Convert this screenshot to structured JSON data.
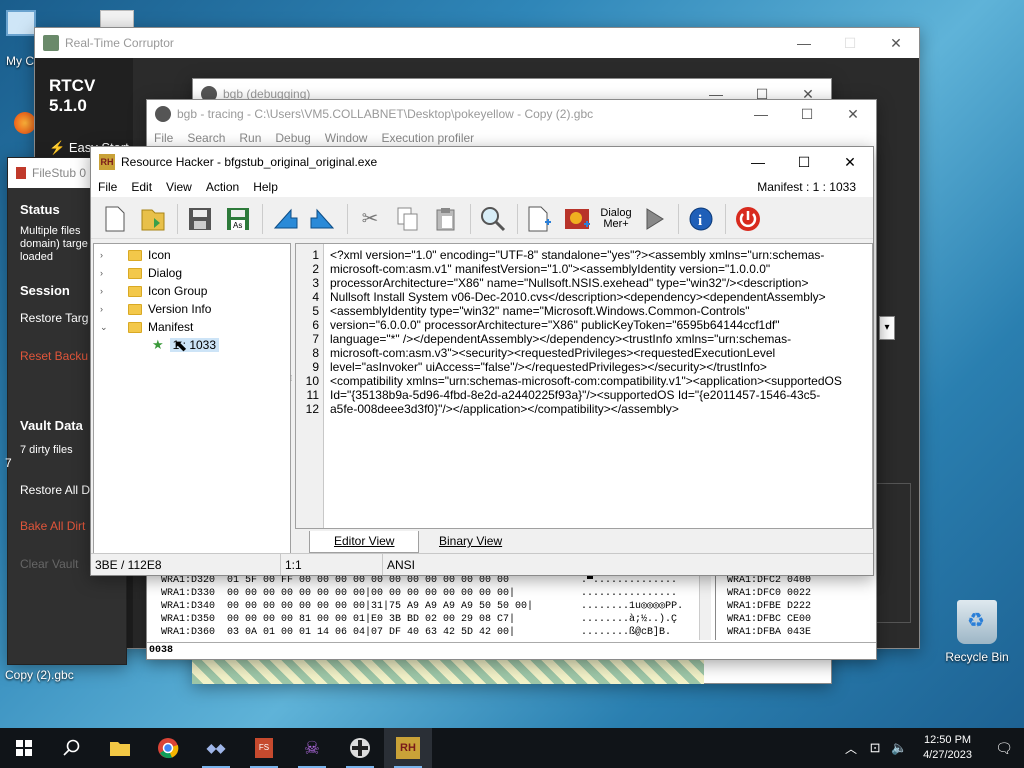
{
  "desktop": {
    "my_computer_label": "My Co",
    "recycle_bin_label": "Recycle Bin",
    "copy_label": "Copy (2).gbc"
  },
  "rtcv": {
    "title": "Real-Time Corruptor",
    "version": "RTCV 5.1.0",
    "easy_start": "Easy Start"
  },
  "filestub": {
    "title": "FileStub 0",
    "status_heading": "Status",
    "status_text_1": "Multiple files",
    "status_text_2": "domain) targe",
    "status_text_3": "loaded",
    "session_heading": "Session",
    "restore_target": "Restore Targ",
    "reset_backup": "Reset Backu",
    "vault_heading": "Vault Data",
    "dirty_files": "7 dirty files",
    "restore_all": "Restore All D",
    "bake_all": "Bake All Dirt",
    "clear_vault": "Clear Vault"
  },
  "bgb_debug": {
    "title": "bgb (debugging)"
  },
  "bgb_trace": {
    "title": "bgb - tracing - C:\\Users\\VM5.COLLABNET\\Desktop\\pokeyellow - Copy (2).gbc",
    "menu": [
      "File",
      "Search",
      "Run",
      "Debug",
      "Window",
      "Execution profiler"
    ],
    "hex_lines": [
      "WRA1:D320  01 5F 00 FF 00 00 00 00 00 00 00 00 00 00 00 00",
      "WRA1:D330  00 00 00 00 00 00 00 00|00 00 00 00 00 00 00 00|",
      "WRA1:D340  00 00 00 00 00 00 00 00|31|75 A9 A9 A9 A9 50 50 00|",
      "WRA1:D350  00 00 00 00 81 00 00 01|E0 3B BD 02 00 29 08 C7|",
      "WRA1:D360  03 0A 01 00 01 14 06 04|07 DF 40 63 42 5D 42 00|"
    ],
    "ascii_lines": [
      ".▀..............",
      "................",
      "........1u◎◎◎◎PP.",
      "........à;½..).Ç",
      "........ß@cB]B."
    ],
    "stack_lines": [
      "WRA1:DFC2 0400",
      "WRA1:DFC0 0022",
      "WRA1:DFBE D222",
      "WRA1:DFBC CE00",
      "WRA1:DFBA 043E"
    ],
    "addr_footer": "0038"
  },
  "resource_hacker": {
    "title": "Resource Hacker - bfgstub_original_original.exe",
    "menu": [
      "File",
      "Edit",
      "View",
      "Action",
      "Help"
    ],
    "manifest_label": "Manifest : 1 : 1033",
    "toolbar_dialog_merge": "Dialog\nMerge",
    "tree": [
      "Icon",
      "Dialog",
      "Icon Group",
      "Version Info",
      "Manifest"
    ],
    "tree_child": "1 : 1033",
    "code_lines": [
      "<?xml version=\"1.0\" encoding=\"UTF-8\" standalone=\"yes\"?><assembly xmlns=\"urn:schemas-",
      "microsoft-com:asm.v1\" manifestVersion=\"1.0\"><assemblyIdentity version=\"1.0.0.0\"",
      "processorArchitecture=\"X86\" name=\"Nullsoft.NSIS.exehead\" type=\"win32\"/><description>",
      "Nullsoft Install System v06-Dec-2010.cvs</description><dependency><dependentAssembly>",
      "<assemblyIdentity type=\"win32\" name=\"Microsoft.Windows.Common-Controls\"",
      "version=\"6.0.0.0\" processorArchitecture=\"X86\" publicKeyToken=\"6595b64144ccf1df\"",
      "language=\"*\" /></dependentAssembly></dependency><trustInfo xmlns=\"urn:schemas-",
      "microsoft-com:asm.v3\"><security><requestedPrivileges><requestedExecutionLevel",
      "level=\"asInvoker\" uiAccess=\"false\"/></requestedPrivileges></security></trustInfo>",
      "<compatibility xmlns=\"urn:schemas-microsoft-com:compatibility.v1\"><application><supportedOS",
      "Id=\"{35138b9a-5d96-4fbd-8e2d-a2440225f93a}\"/><supportedOS Id=\"{e2011457-1546-43c5-",
      "a5fe-008deee3d3f0}\"/></application></compatibility></assembly>"
    ],
    "tab_editor": "Editor View",
    "tab_binary": "Binary View",
    "status_offset": "3BE / 112E8",
    "status_pos": "1:1",
    "status_enc": "ANSI"
  },
  "taskbar": {
    "time": "12:50 PM",
    "date": "4/27/2023",
    "apps": [
      "file-explorer",
      "chrome",
      "rtcv",
      "filestub",
      "bgb-monster",
      "bgb",
      "resource-hacker"
    ]
  }
}
